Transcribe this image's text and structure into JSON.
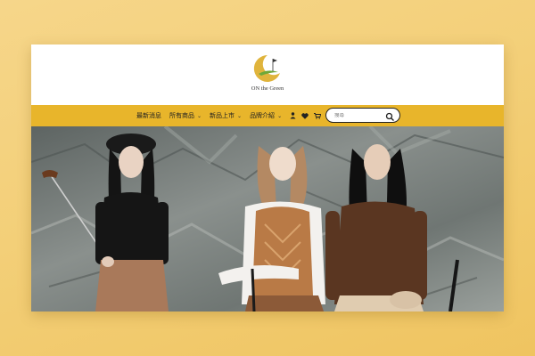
{
  "brand": {
    "name": "ON the Green",
    "accent": "#e8b52b"
  },
  "nav": {
    "items": [
      {
        "label": "最新消息",
        "has_dropdown": false
      },
      {
        "label": "所有商品",
        "has_dropdown": true
      },
      {
        "label": "新品上市",
        "has_dropdown": true
      },
      {
        "label": "品牌介紹",
        "has_dropdown": true
      }
    ],
    "icons": [
      "user-icon",
      "heart-icon",
      "cart-icon"
    ]
  },
  "search": {
    "placeholder": "搜尋",
    "icon": "search-icon"
  },
  "hero": {
    "description_icon": "hero-image"
  }
}
